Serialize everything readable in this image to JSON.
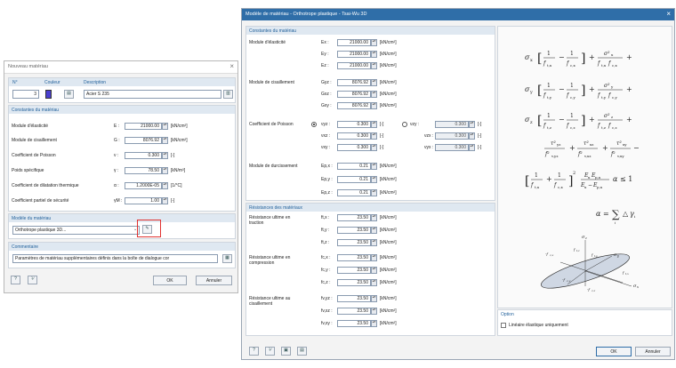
{
  "material_dialog": {
    "title": "Nouveau matériau",
    "no_label": "N°",
    "no_value": "3",
    "color_label": "Couleur",
    "color_value": "#4a3fd0",
    "description_label": "Description",
    "description_value": "Acier S 235",
    "constants": {
      "heading": "Constantes du matériau",
      "rows": [
        {
          "label": "Module d'élasticité",
          "symbol": "E :",
          "value": "21000.00",
          "unit": "[kN/cm²]"
        },
        {
          "label": "Module de cisaillement",
          "symbol": "G :",
          "value": "8076.92",
          "unit": "[kN/cm²]"
        },
        {
          "label": "Coefficient de Poisson",
          "symbol": "ν :",
          "value": "0.300",
          "unit": "[-]"
        },
        {
          "label": "Poids spécifique",
          "symbol": "γ :",
          "value": "78.50",
          "unit": "[kN/m³]"
        },
        {
          "label": "Coefficient de dilatation thermique",
          "symbol": "α :",
          "value": "1.2000E-05",
          "unit": "[1/°C]"
        },
        {
          "label": "Coefficient partiel de sécurité",
          "symbol": "γM :",
          "value": "1.00",
          "unit": "[-]"
        }
      ]
    },
    "model": {
      "heading": "Modèle du matériau",
      "value": "Orthotrope plastique 3D..."
    },
    "comment": {
      "heading": "Commentaire",
      "value": "Paramètres de matériau supplémentaires définis dans la boîte de dialogue cor"
    },
    "ok_label": "OK",
    "cancel_label": "Annuler"
  },
  "model_dialog": {
    "title": "Modèle de matériau - Orthotrope plastique - Tsai-Wu 3D",
    "constants_heading": "Constantes du matériau",
    "elastic_label": "Module d'élasticité",
    "elastic": [
      {
        "symbol": "Ex :",
        "value": "21000.00",
        "unit": "[kN/cm²]"
      },
      {
        "symbol": "Ey :",
        "value": "21000.00",
        "unit": "[kN/cm²]"
      },
      {
        "symbol": "Ez :",
        "value": "21000.00",
        "unit": "[kN/cm²]"
      }
    ],
    "shear_label": "Module de cisaillement",
    "shear": [
      {
        "symbol": "Gyz :",
        "value": "8076.92",
        "unit": "[kN/cm²]"
      },
      {
        "symbol": "Gxz :",
        "value": "8076.92",
        "unit": "[kN/cm²]"
      },
      {
        "symbol": "Gxy :",
        "value": "8076.92",
        "unit": "[kN/cm²]"
      }
    ],
    "poisson_label": "Coefficient de Poisson",
    "poisson_left": [
      {
        "symbol": "νyz :",
        "value": "0.300",
        "unit": "[-]"
      },
      {
        "symbol": "νxz :",
        "value": "0.300",
        "unit": "[-]"
      },
      {
        "symbol": "νxy :",
        "value": "0.300",
        "unit": "[-]"
      }
    ],
    "poisson_right": [
      {
        "symbol": "νzy :",
        "value": "0.300",
        "unit": "[-]"
      },
      {
        "symbol": "νzx :",
        "value": "0.300",
        "unit": "[-]"
      },
      {
        "symbol": "νyx :",
        "value": "0.300",
        "unit": "[-]"
      }
    ],
    "hardening_label": "Module de durcissement",
    "hardening": [
      {
        "symbol": "Ep,x :",
        "value": "0.21",
        "unit": "[kN/cm²]"
      },
      {
        "symbol": "Ep,y :",
        "value": "0.21",
        "unit": "[kN/cm²]"
      },
      {
        "symbol": "Ep,z :",
        "value": "0.21",
        "unit": "[kN/cm²]"
      }
    ],
    "strength_heading": "Résistances des matériaux",
    "tension_label": "Résistance ultime en traction",
    "tension": [
      {
        "symbol": "ft,x :",
        "value": "23.50",
        "unit": "[kN/cm²]"
      },
      {
        "symbol": "ft,y :",
        "value": "23.50",
        "unit": "[kN/cm²]"
      },
      {
        "symbol": "ft,z :",
        "value": "23.50",
        "unit": "[kN/cm²]"
      }
    ],
    "compression_label": "Résistance ultime en compression",
    "compression": [
      {
        "symbol": "fc,x :",
        "value": "23.50",
        "unit": "[kN/cm²]"
      },
      {
        "symbol": "fc,y :",
        "value": "23.50",
        "unit": "[kN/cm²]"
      },
      {
        "symbol": "fc,z :",
        "value": "23.50",
        "unit": "[kN/cm²]"
      }
    ],
    "shear_strength_label": "Résistance ultime au cisaillement",
    "shear_strength": [
      {
        "symbol": "fv,yz :",
        "value": "23.50",
        "unit": "[kN/cm²]"
      },
      {
        "symbol": "fv,xz :",
        "value": "23.50",
        "unit": "[kN/cm²]"
      },
      {
        "symbol": "fv,xy :",
        "value": "23.50",
        "unit": "[kN/cm²]"
      }
    ],
    "option_heading": "Option",
    "option_label": "Linéaire élastique uniquement",
    "ok_label": "OK",
    "cancel_label": "Annuler"
  }
}
